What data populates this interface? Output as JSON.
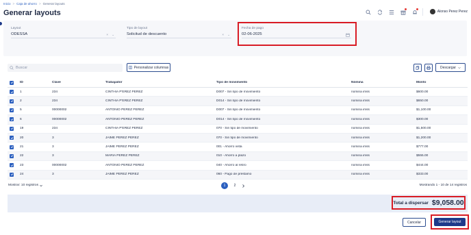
{
  "breadcrumb": {
    "items": [
      "Inicio",
      "Caja de ahorro",
      "Generar layouts"
    ]
  },
  "page": {
    "title": "Generar layouts"
  },
  "header": {
    "user_name": "Alonso Perez Perez",
    "icons": [
      "search-icon",
      "sync-icon",
      "list-icon",
      "gift-icon",
      "bell-icon"
    ]
  },
  "filters": {
    "layout": {
      "label": "Layout",
      "value": "ODESSA"
    },
    "tipo": {
      "label": "Tipo de layout",
      "value": "Solicitud de descuento"
    },
    "fecha": {
      "label": "Fecha de pago",
      "value": "02-06-2025"
    }
  },
  "toolbar": {
    "search_placeholder": "Buscar",
    "personalizar_label": "Personalizar columnas",
    "descargar_label": "Descargar"
  },
  "table": {
    "headers": [
      "ID",
      "Clave",
      "Trabajador",
      "Tipo de movimiento",
      "Nómina",
      "Monto"
    ],
    "rows": [
      [
        "1",
        "234",
        "CINTHIA P'EREZ PEREZ",
        "D007 - Sin tipo de movimiento",
        "nomina imss",
        "$600.00"
      ],
      [
        "2",
        "234",
        "CINTHIA P'EREZ PEREZ",
        "D014 - Sin tipo de movimiento",
        "nomina imss",
        "$650.00"
      ],
      [
        "5",
        "00000002",
        "ANTOÑIO PEREZ PEREZ",
        "D007 - Sin tipo de movimiento",
        "nomina imss",
        "$1,100.00"
      ],
      [
        "6",
        "00000002",
        "ANTOÑIO PEREZ PEREZ",
        "D014 - Sin tipo de movimiento",
        "nomina imss",
        "$300.00"
      ],
      [
        "19",
        "234",
        "CINTHIA P'EREZ PEREZ",
        "070 - Sin tipo de movimiento",
        "nomina imss",
        "$1,500.00"
      ],
      [
        "20",
        "3",
        "JAIME PEREZ PEREZ",
        "070 - Sin tipo de movimiento",
        "nomina imss",
        "$1,200.00"
      ],
      [
        "21",
        "3",
        "JAIME PEREZ PEREZ",
        "001 - Ahorro vista",
        "nomina imss",
        "$777.00"
      ],
      [
        "22",
        "3",
        "MARIA PEREZ PEREZ",
        "010 - Ahorro a plazo",
        "nomina imss",
        "$555.00"
      ],
      [
        "23",
        "00000002",
        "ANTOÑIO PEREZ PEREZ",
        "040 - Ahorro al retiro",
        "nomina imss",
        "$444.00"
      ],
      [
        "24",
        "3",
        "JAIME PEREZ PEREZ",
        "060 - Pago de préstamo",
        "nomina imss",
        "$333.00"
      ]
    ]
  },
  "pagination": {
    "mostrar": "Mostrar: 10 registros",
    "pages": [
      "1",
      "2"
    ],
    "active_page": "1",
    "summary": "Mostrando 1 - 10 de 14 registros"
  },
  "totals": {
    "label": "Total a dispersar",
    "value": "$9,058.00"
  },
  "actions": {
    "cancel_label": "Cancelar",
    "generate_label": "Generar layout"
  },
  "colors": {
    "accent": "#2b5fbf",
    "primary_dark": "#1e3a8a",
    "highlight_red": "#d81b24"
  }
}
